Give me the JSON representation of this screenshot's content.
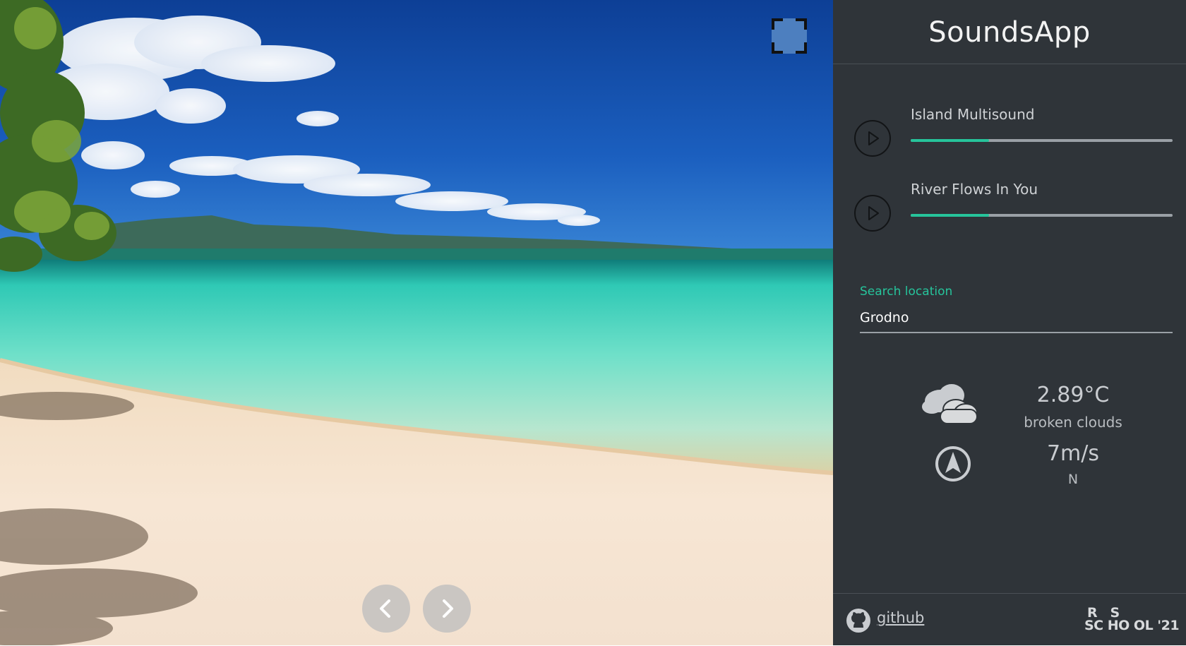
{
  "app": {
    "title": "SoundsApp"
  },
  "player": {
    "tracks": [
      {
        "title": "Island Multisound",
        "progress": 0.3
      },
      {
        "title": "River Flows In You",
        "progress": 0.3
      }
    ],
    "icons": {
      "play": "play-icon",
      "fullscreen": "fullscreen-icon",
      "prev": "chevron-left-icon",
      "next": "chevron-right-icon"
    }
  },
  "search": {
    "label": "Search location",
    "value": "Grodno"
  },
  "weather": {
    "temperature": "2.89°C",
    "description": "broken clouds",
    "wind_speed": "7m/s",
    "wind_direction": "N",
    "icons": {
      "condition": "cloud-icon",
      "wind": "compass-icon"
    }
  },
  "footer": {
    "github_label": "github",
    "logo_line1": "R   S",
    "logo_line2": "SC HO OL '21",
    "icons": {
      "github": "github-icon",
      "logo": "rs-school-logo"
    }
  },
  "colors": {
    "sidebar_bg": "#2f3439",
    "accent": "#26c49b",
    "fullscreen_button": "#4d7fbf"
  }
}
